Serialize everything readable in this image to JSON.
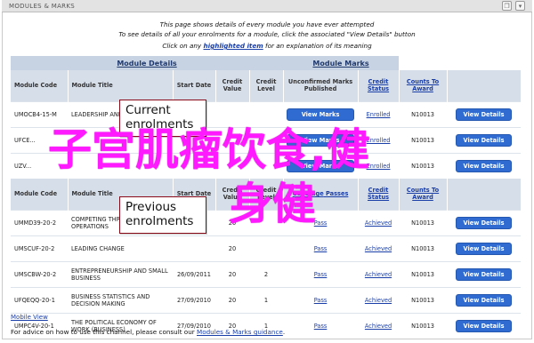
{
  "window": {
    "title": "MODULES & MARKS"
  },
  "intro": {
    "line1": "This page shows details of every module you have ever attempted",
    "line2": "To see details of all your enrolments for a module, click the associated \"View Details\" button",
    "line3_pre": "Click on any",
    "line3_link": "highlighted item",
    "line3_post": "for an explanation of its meaning"
  },
  "table": {
    "group_headers": {
      "details": "Module Details",
      "marks": "Module Marks"
    },
    "columns": [
      "Module Code",
      "Module Title",
      "Start Date",
      "Credit Value",
      "Credit Level",
      "Unconfirmed Marks Published",
      "Credit Status",
      "Counts To Award"
    ],
    "current_rows": [
      {
        "code": "UMOCB4-15-M",
        "title": "LEADERSHIP AND",
        "start": "",
        "value": "",
        "level": "",
        "marks_button": "View Marks",
        "status": "Enrolled",
        "award": "N10013",
        "button": "View Details"
      },
      {
        "code": "UFCE...",
        "title": "",
        "start": "",
        "value": "",
        "level": "",
        "marks_button": "View Marks",
        "status": "Enrolled",
        "award": "N10013",
        "button": "View Details"
      },
      {
        "code": "UZV...",
        "title": "",
        "start": "",
        "value": "",
        "level": "",
        "marks_button": "View Marks",
        "status": "Enrolled",
        "award": "N10013",
        "button": "View Details"
      }
    ],
    "previous_header": {
      "code": "Module Code",
      "title": "Module Title",
      "start": "Start Date",
      "value": "Credit Value",
      "level": "Credit Level",
      "coverage": "Coverage",
      "passes": "Passes",
      "status": "Credit Status",
      "award": "Counts To Award"
    },
    "previous_rows": [
      {
        "code": "UMMD39-20-2",
        "title": "COMPETING THROUGH OPERATIONS",
        "start": "",
        "value": "20",
        "level": "",
        "result": "Pass",
        "status": "Achieved",
        "award": "N10013",
        "button": "View Details"
      },
      {
        "code": "UMSCUF-20-2",
        "title": "LEADING CHANGE",
        "start": "",
        "value": "20",
        "level": "",
        "result": "Pass",
        "status": "Achieved",
        "award": "N10013",
        "button": "View Details"
      },
      {
        "code": "UMSCBW-20-2",
        "title": "ENTREPRENEURSHIP AND SMALL BUSINESS",
        "start": "26/09/2011",
        "value": "20",
        "level": "2",
        "result": "Pass",
        "status": "Achieved",
        "award": "N10013",
        "button": "View Details"
      },
      {
        "code": "UFQEQQ-20-1",
        "title": "BUSINESS STATISTICS AND DECISION MAKING",
        "start": "27/09/2010",
        "value": "20",
        "level": "1",
        "result": "Pass",
        "status": "Achieved",
        "award": "N10013",
        "button": "View Details"
      },
      {
        "code": "UMPC4V-20-1",
        "title": "THE POLITICAL ECONOMY OF WORK (BUSINESS)",
        "start": "27/09/2010",
        "value": "20",
        "level": "1",
        "result": "Pass",
        "status": "Achieved",
        "award": "N10013",
        "button": "View Details"
      }
    ]
  },
  "callouts": {
    "current": "Current enrolments",
    "previous": "Previous enrolments"
  },
  "overlay": {
    "line1": "子宫肌瘤饮食,健",
    "line2": "身健"
  },
  "links": {
    "mobile": "Mobile View"
  },
  "footer": {
    "text": "For advice on how to use this channel, please consult our",
    "link": "Modules & Marks guidance",
    "end": "."
  }
}
